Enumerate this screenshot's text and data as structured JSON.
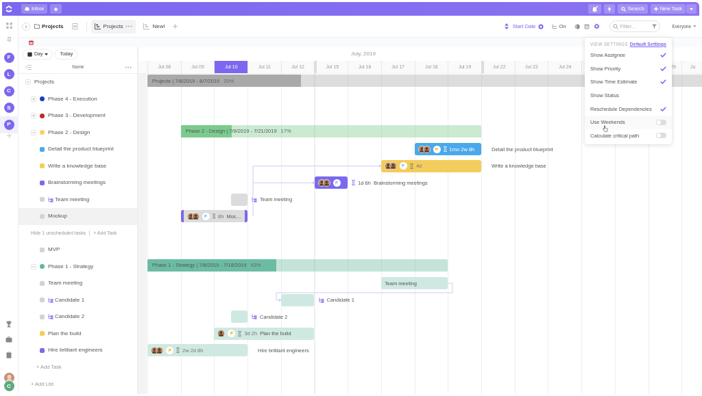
{
  "topbar": {
    "inbox": "Inbox",
    "search": "Search",
    "new_task": "New Task",
    "notifications": true
  },
  "rail": {
    "avatars": [
      {
        "initial": "F",
        "selected": false
      },
      {
        "initial": "L",
        "selected": false
      },
      {
        "initial": "C",
        "selected": false
      },
      {
        "initial": "S",
        "selected": false
      },
      {
        "initial": "P",
        "selected": true
      }
    ],
    "user_initial": "C"
  },
  "header": {
    "breadcrumb": "Projects",
    "tabs": [
      {
        "label": "Projects",
        "selected": true
      },
      {
        "label": "New!",
        "selected": false
      }
    ],
    "sort_label": "Start Date",
    "subtasks_label": "On",
    "filter_placeholder": "Filter...",
    "assignee_filter": "Everyone"
  },
  "list": {
    "scale": "Day",
    "today": "Today",
    "column": "Name",
    "add_list": "+ Add List",
    "rows": [
      {
        "kind": "project",
        "label": "Projects",
        "expanded": true,
        "bar": {
          "kind": "summary",
          "title": "Projects | 7/8/2019 - 8/7/2019",
          "percent": "20%",
          "level": 0.2,
          "color": "#a9a9a9"
        },
        "children": [
          {
            "kind": "phase",
            "label": "Phase 4 - Execution",
            "color": "#1f3cc0",
            "expanded": false
          },
          {
            "kind": "phase",
            "label": "Phase 3 - Development",
            "color": "#c0282d",
            "expanded": false
          },
          {
            "kind": "phase",
            "label": "Phase 2 - Design",
            "color": "#f5d264",
            "expanded": true,
            "bar": {
              "kind": "summary",
              "title": "Phase 2 - Design | 7/9/2019 - 7/21/2019",
              "percent": "17%",
              "level": 0.17,
              "color": "#7ccb8e"
            },
            "children": [
              {
                "kind": "task",
                "label": "Detail the product blueprint",
                "color": "#4aa8ec",
                "selected": false,
                "subtasks": false,
                "bar": {
                  "kind": "task",
                  "color": "#4aa8ec",
                  "assignees": [
                    {
                      "kind": "photo"
                    },
                    {
                      "kind": "photo"
                    }
                  ],
                  "flag": {
                    "color": "#f5c542"
                  },
                  "estimate": "1mo 2w 8h",
                  "estimate_outside": false,
                  "caption": "Detail the product blueprint",
                  "caption_outside": true
                }
              },
              {
                "kind": "task",
                "label": "Write a knowledge base",
                "color": "#f3cd5b",
                "selected": false,
                "subtasks": false,
                "bar": {
                  "kind": "task",
                  "color": "#f3cd5b",
                  "assignees": [
                    {
                      "kind": "photo"
                    },
                    {
                      "kind": "photo"
                    }
                  ],
                  "flag": {
                    "color": "#8fd3f5"
                  },
                  "estimate": "4d",
                  "estimate_outside": false,
                  "caption": "Write a knowledge base",
                  "caption_outside": true
                }
              },
              {
                "kind": "task",
                "label": "Brainstorming meetings",
                "color": "#7b68ee",
                "selected": false,
                "subtasks": false,
                "bar": {
                  "kind": "task",
                  "color": "#7b68ee",
                  "assignees": [
                    {
                      "kind": "photo"
                    },
                    {
                      "kind": "photo"
                    }
                  ],
                  "flag": {
                    "color": "#8fd3f5"
                  },
                  "estimate": "1d 6h",
                  "estimate_outside": true,
                  "caption": "Brainstorming meetings",
                  "caption_outside": true
                }
              },
              {
                "kind": "task",
                "label": "Team meeting",
                "color": "#d3d3d3",
                "selected": false,
                "subtasks": true,
                "bar": {
                  "kind": "task",
                  "color": "#dcdcdc",
                  "caption": "Team meeting",
                  "caption_outside": true
                }
              },
              {
                "kind": "task",
                "label": "Mockup",
                "color": "#d3d3d3",
                "selected": true,
                "subtasks": false,
                "bar": {
                  "kind": "task",
                  "color": "#dcdcdc",
                  "assignees": [
                    {
                      "kind": "photo"
                    },
                    {
                      "kind": "photo"
                    }
                  ],
                  "flag": {
                    "color": "#8fd3f5"
                  },
                  "estimate": "8h",
                  "estimate_outside": false,
                  "caption": "Moc…",
                  "caption_outside": false
                }
              }
            ]
          },
          {
            "kind": "unscheduled",
            "label": "Hide 1 unscheduled tasks",
            "action": "+ Add Task",
            "children": [
              {
                "kind": "task",
                "label": "MVP",
                "color": "#d3d3d3",
                "selected": false,
                "subtasks": false
              }
            ]
          },
          {
            "kind": "phase",
            "label": "Phase 1 - Strategy",
            "color": "#5fb89a",
            "expanded": true,
            "bar": {
              "kind": "summary",
              "title": "Phase 1 - Strategy | 7/8/2019 - 7/18/2019",
              "percent": "43%",
              "level": 0.43,
              "color": "#6cbca3"
            },
            "children": [
              {
                "kind": "task",
                "label": "Team meeting",
                "color": "#d3d3d3",
                "selected": false,
                "subtasks": false,
                "bar": {
                  "kind": "task",
                  "color": "#cfe9e2",
                  "caption": "Team meeting",
                  "caption_outside": false
                }
              },
              {
                "kind": "task",
                "label": "Candidate 1",
                "color": "#d3d3d3",
                "selected": false,
                "subtasks": true,
                "bar": {
                  "kind": "task",
                  "color": "#cfe9e2",
                  "caption": "Candidate 1",
                  "caption_outside": true
                }
              },
              {
                "kind": "task",
                "label": "Candidate 2",
                "color": "#d3d3d3",
                "selected": false,
                "subtasks": true,
                "bar": {
                  "kind": "task",
                  "color": "#cfe9e2",
                  "caption": "Candidate 2",
                  "caption_outside": true
                }
              },
              {
                "kind": "task",
                "label": "Plan the build",
                "color": "#f3cd5b",
                "selected": false,
                "subtasks": false,
                "bar": {
                  "kind": "task",
                  "color": "#cfe9e2",
                  "assignees": [
                    {
                      "kind": "photo"
                    }
                  ],
                  "flag": {
                    "color": "#f5c542"
                  },
                  "estimate": "3d 2h",
                  "estimate_outside": false,
                  "caption": "Plan the build",
                  "caption_outside": false
                }
              },
              {
                "kind": "task",
                "label": "Hire brilliant engineers",
                "color": "#7b68ee",
                "selected": false,
                "subtasks": false,
                "bar": {
                  "kind": "task",
                  "color": "#cfe9e2",
                  "assignees": [
                    {
                      "kind": "photo"
                    },
                    {
                      "kind": "photo"
                    }
                  ],
                  "flag": {
                    "color": "#f5c542"
                  },
                  "estimate": "2w 2d 8h",
                  "estimate_outside": false,
                  "caption": "Hire brilliant engineers",
                  "caption_outside": true
                }
              },
              {
                "kind": "add",
                "label": "+ Add Task"
              }
            ]
          }
        ]
      }
    ]
  },
  "timeline": {
    "month": "July, 2019",
    "days": [
      {
        "label": "Jul 08",
        "selected": false,
        "week_start": false
      },
      {
        "label": "Jul 09",
        "selected": false,
        "week_start": false
      },
      {
        "label": "Jul 10",
        "selected": true,
        "week_start": false
      },
      {
        "label": "Jul 11",
        "selected": false,
        "week_start": false
      },
      {
        "label": "Jul 12",
        "selected": false,
        "week_start": false
      },
      {
        "label": "Jul 15",
        "selected": false,
        "week_start": true
      },
      {
        "label": "Jul 16",
        "selected": false,
        "week_start": false
      },
      {
        "label": "Jul 17",
        "selected": false,
        "week_start": false
      },
      {
        "label": "Jul 18",
        "selected": false,
        "week_start": false
      },
      {
        "label": "Jul 19",
        "selected": false,
        "week_start": false
      },
      {
        "label": "Jul 22",
        "selected": false,
        "week_start": true
      },
      {
        "label": "Jul 23",
        "selected": false,
        "week_start": false
      },
      {
        "label": "Jul 24",
        "selected": false,
        "week_start": false
      },
      {
        "label": "29",
        "selected": false,
        "follows_covered_days": true
      },
      {
        "label": "Ju",
        "selected": false,
        "week_start": false
      }
    ]
  },
  "settings_menu": {
    "title": "VIEW SETTINGS",
    "link": "Default Settings",
    "options": [
      {
        "label": "Show Assignee",
        "kind": "check",
        "on": true
      },
      {
        "label": "Show Priority",
        "kind": "check",
        "on": true
      },
      {
        "label": "Show Time Estimate",
        "kind": "check",
        "on": true
      },
      {
        "label": "Show Status",
        "kind": "check",
        "on": false
      },
      {
        "label": "Reschedule Dependencies",
        "kind": "check",
        "on": true
      },
      {
        "label": "Use Weekends",
        "kind": "toggle",
        "on": false,
        "hovered": true
      },
      {
        "label": "Calculate critical path",
        "kind": "toggle",
        "on": false
      }
    ]
  }
}
